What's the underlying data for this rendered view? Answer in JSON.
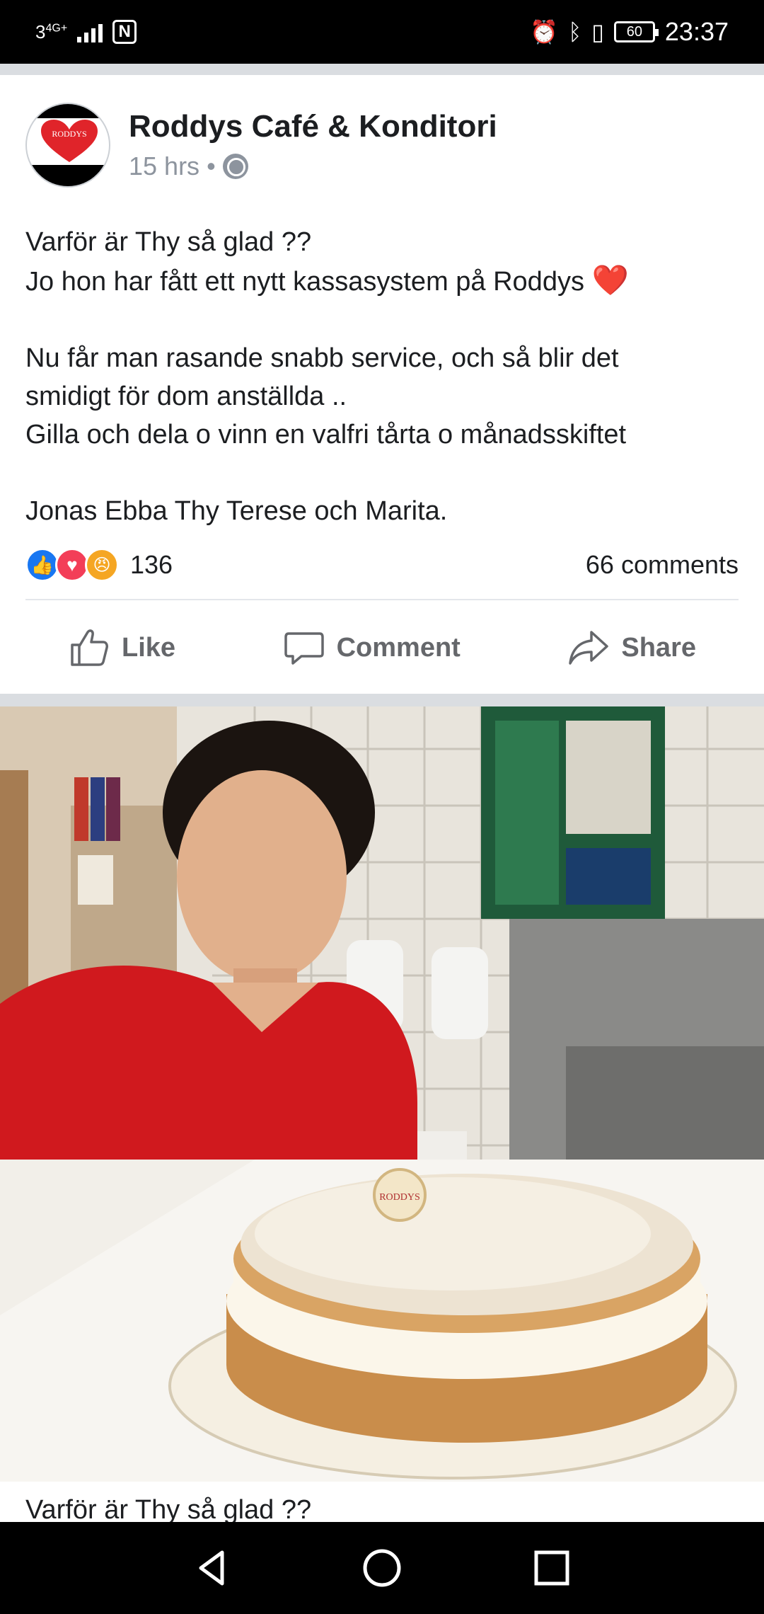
{
  "status_bar": {
    "network": "3",
    "network_type": "4G+",
    "nfc": "N",
    "battery": "60",
    "time": "23:37"
  },
  "post": {
    "author": "Roddys Café & Konditori",
    "avatar_text": "RODDYS",
    "time_ago": "15 hrs",
    "separator": "•",
    "privacy_icon": "globe-icon",
    "text_lines": {
      "l1": "Varför är Thy så glad ??",
      "l2": "Jo hon har fått ett nytt kassasystem på Roddys",
      "l2_emoji": "❤️",
      "l3": "Nu får man rasande snabb service, och så blir det",
      "l4": "smidigt för dom anställda ..",
      "l5": "Gilla och dela o vinn en valfri tårta o månadsskiftet",
      "l6": "Jonas Ebba Thy Terese och Marita."
    },
    "reactions": {
      "count": "136",
      "comments": "66 comments",
      "icons": [
        "like-icon",
        "love-icon",
        "angry-icon"
      ]
    },
    "actions": {
      "like": "Like",
      "comment": "Comment",
      "share": "Share"
    },
    "cake_topper": "RODDYS"
  },
  "next_caption": "Varför är Thy så glad ??",
  "colors": {
    "facebook_blue": "#1877f2",
    "love_red": "#f33e58",
    "angry_orange": "#f5a623",
    "meta_gray": "#8d949e",
    "action_gray": "#65676b",
    "separator_gray": "#dadde1"
  }
}
